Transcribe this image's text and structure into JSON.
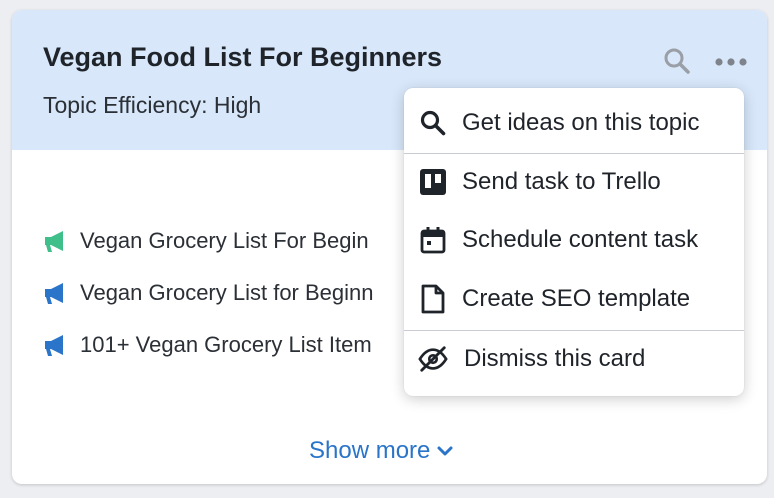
{
  "card": {
    "title": "Vegan Food List For Beginners",
    "subtitle": "Topic Efficiency: High",
    "header_bg": "#d8e8fa",
    "results": [
      {
        "text": "Vegan Grocery List For Begin",
        "icon": "megaphone-icon",
        "color": "#3fbf8a"
      },
      {
        "text": "Vegan Grocery List for Beginn",
        "icon": "megaphone-icon",
        "color": "#2a74c9"
      },
      {
        "text": "101+ Vegan Grocery List Item",
        "icon": "megaphone-icon",
        "color": "#2a74c9"
      }
    ],
    "show_more_label": "Show more"
  },
  "menu": {
    "items": [
      {
        "label": "Get ideas on this topic",
        "icon": "search-icon"
      },
      {
        "label": "Send task to Trello",
        "icon": "trello-icon"
      },
      {
        "label": "Schedule content task",
        "icon": "calendar-icon"
      },
      {
        "label": "Create SEO template",
        "icon": "document-icon"
      },
      {
        "label": "Dismiss this card",
        "icon": "eye-slash-icon"
      }
    ]
  },
  "colors": {
    "accent": "#2a74c9",
    "positive": "#3fbf8a",
    "text": "#1f232a"
  }
}
